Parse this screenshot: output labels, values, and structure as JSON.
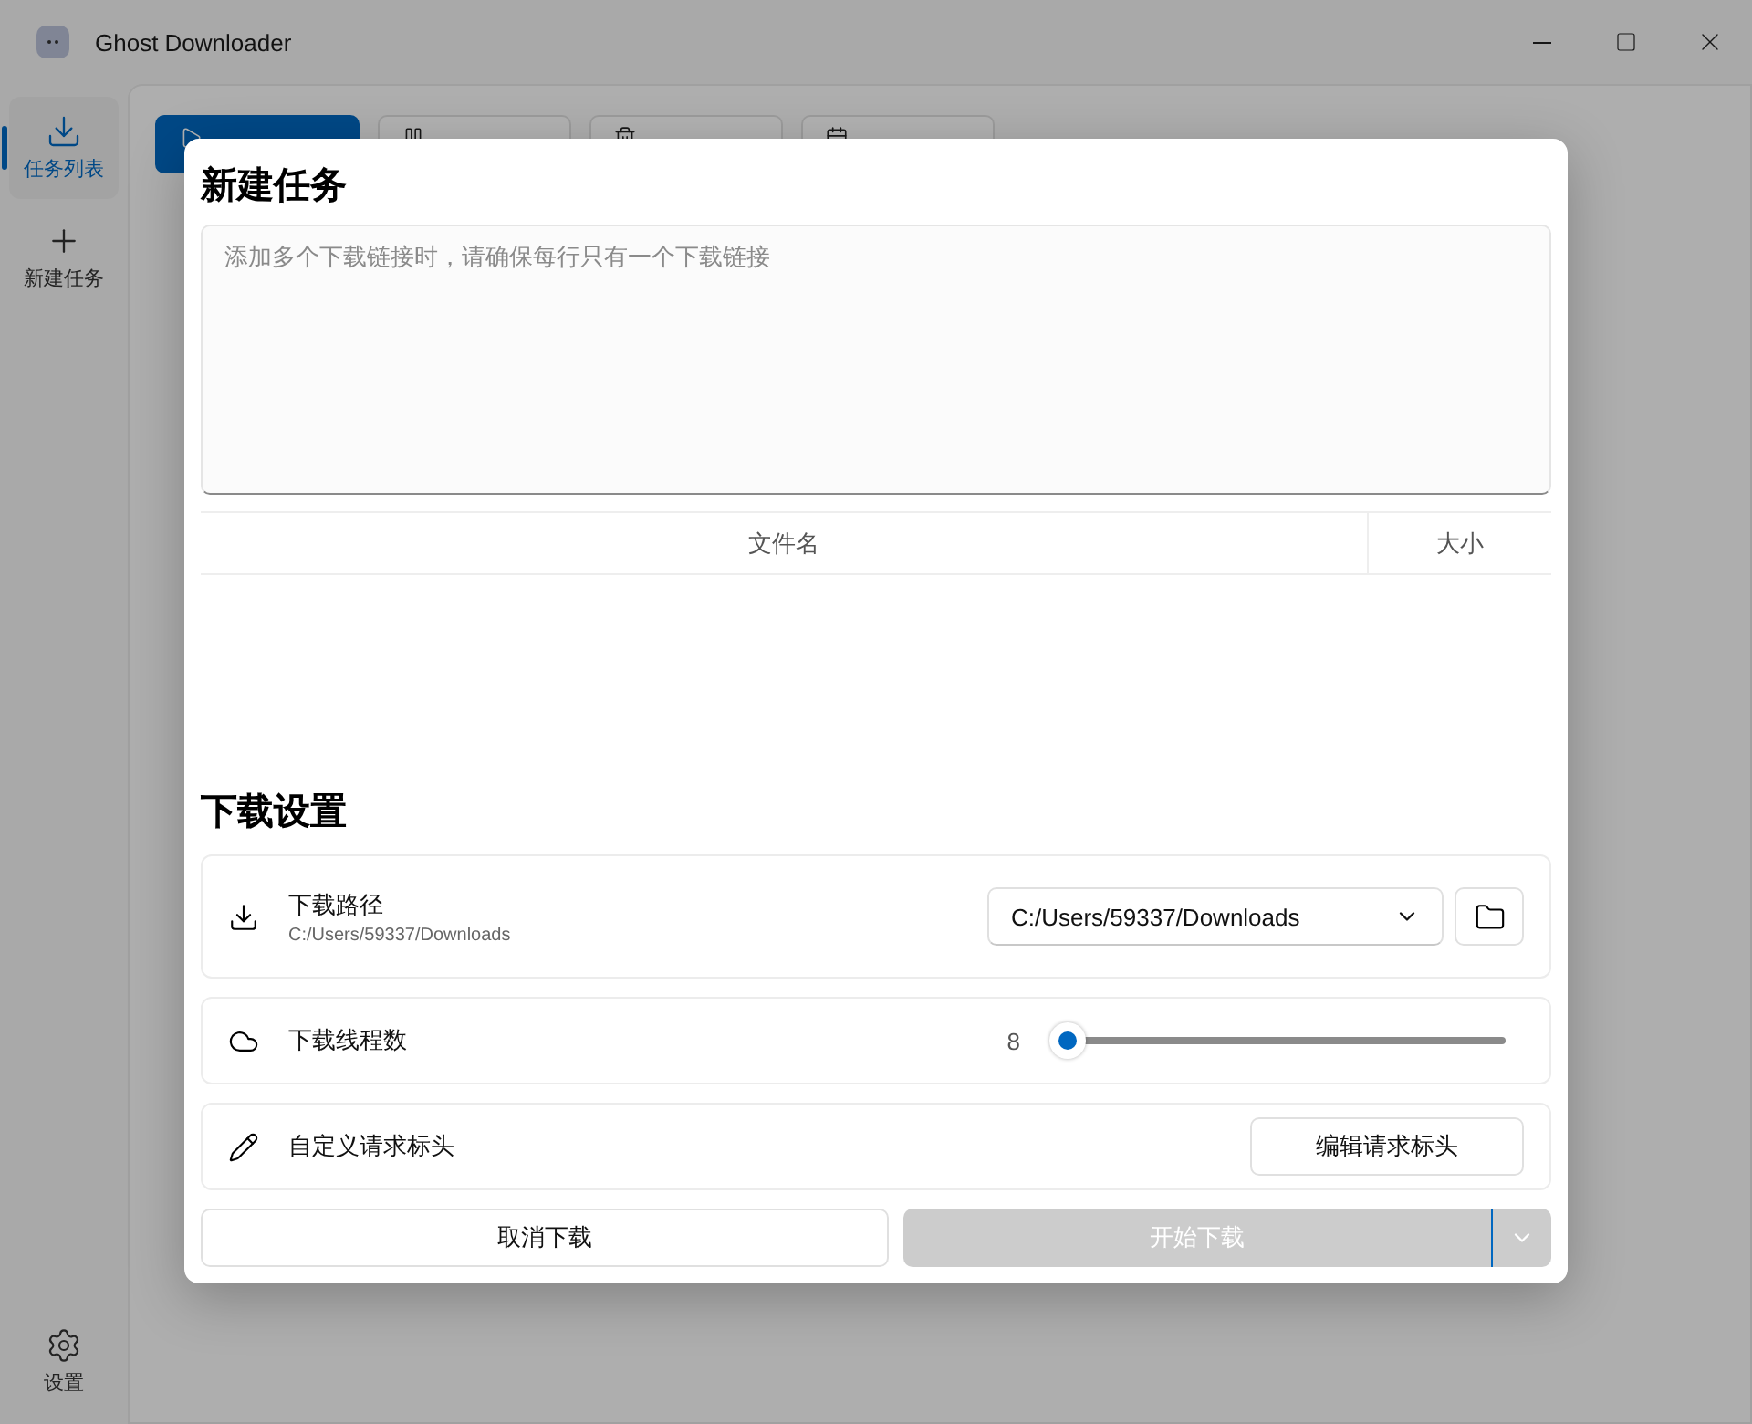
{
  "window": {
    "title": "Ghost Downloader"
  },
  "sidebar": {
    "items": [
      {
        "label": "任务列表",
        "selected": true
      },
      {
        "label": "新建任务",
        "selected": false
      }
    ],
    "settings": "设置"
  },
  "toolbar_buttons": [
    {
      "primary": true
    },
    {
      "primary": false
    },
    {
      "primary": false
    },
    {
      "primary": false
    }
  ],
  "dialog": {
    "title": "新建任务",
    "links": {
      "placeholder": "添加多个下载链接时，请确保每行只有一个下载链接"
    },
    "table": {
      "columns": [
        "文件名",
        "大小"
      ]
    },
    "section": "下载设置",
    "settings": [
      {
        "kind": "path",
        "title": "下载路径",
        "subtitle": "C:/Users/59337/Downloads",
        "value": "C:/Users/59337/Downloads"
      },
      {
        "kind": "slider",
        "title": "下载线程数",
        "reading": "8",
        "level": 0
      },
      {
        "kind": "button",
        "title": "自定义请求标头",
        "button": "编辑请求标头"
      }
    ],
    "cancel": "取消下载",
    "start": {
      "label": "开始下载",
      "disabled": true
    }
  }
}
